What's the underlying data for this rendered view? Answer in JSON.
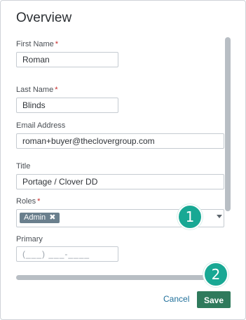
{
  "panel": {
    "title": "Overview"
  },
  "form": {
    "first_name": {
      "label": "First Name",
      "required": "*",
      "value": "Roman"
    },
    "last_name": {
      "label": "Last Name",
      "required": "*",
      "value": "Blinds"
    },
    "email": {
      "label": "Email Address",
      "value": "roman+buyer@theclovergroup.com"
    },
    "title": {
      "label": "Title",
      "value": "Portage / Clover DD"
    },
    "roles": {
      "label": "Roles",
      "required": "*",
      "chip": "Admin",
      "chip_remove": "✖"
    },
    "primary": {
      "label": "Primary",
      "placeholder": "(___) ___-____"
    }
  },
  "badges": {
    "one": "1",
    "two": "2"
  },
  "footer": {
    "cancel_label": "Cancel",
    "save_label": "Save"
  },
  "colors": {
    "accent": "#18a894",
    "save_button": "#2f7a5c",
    "link": "#1f6f9a",
    "required": "#c62828",
    "chip": "#6a7f8d"
  }
}
